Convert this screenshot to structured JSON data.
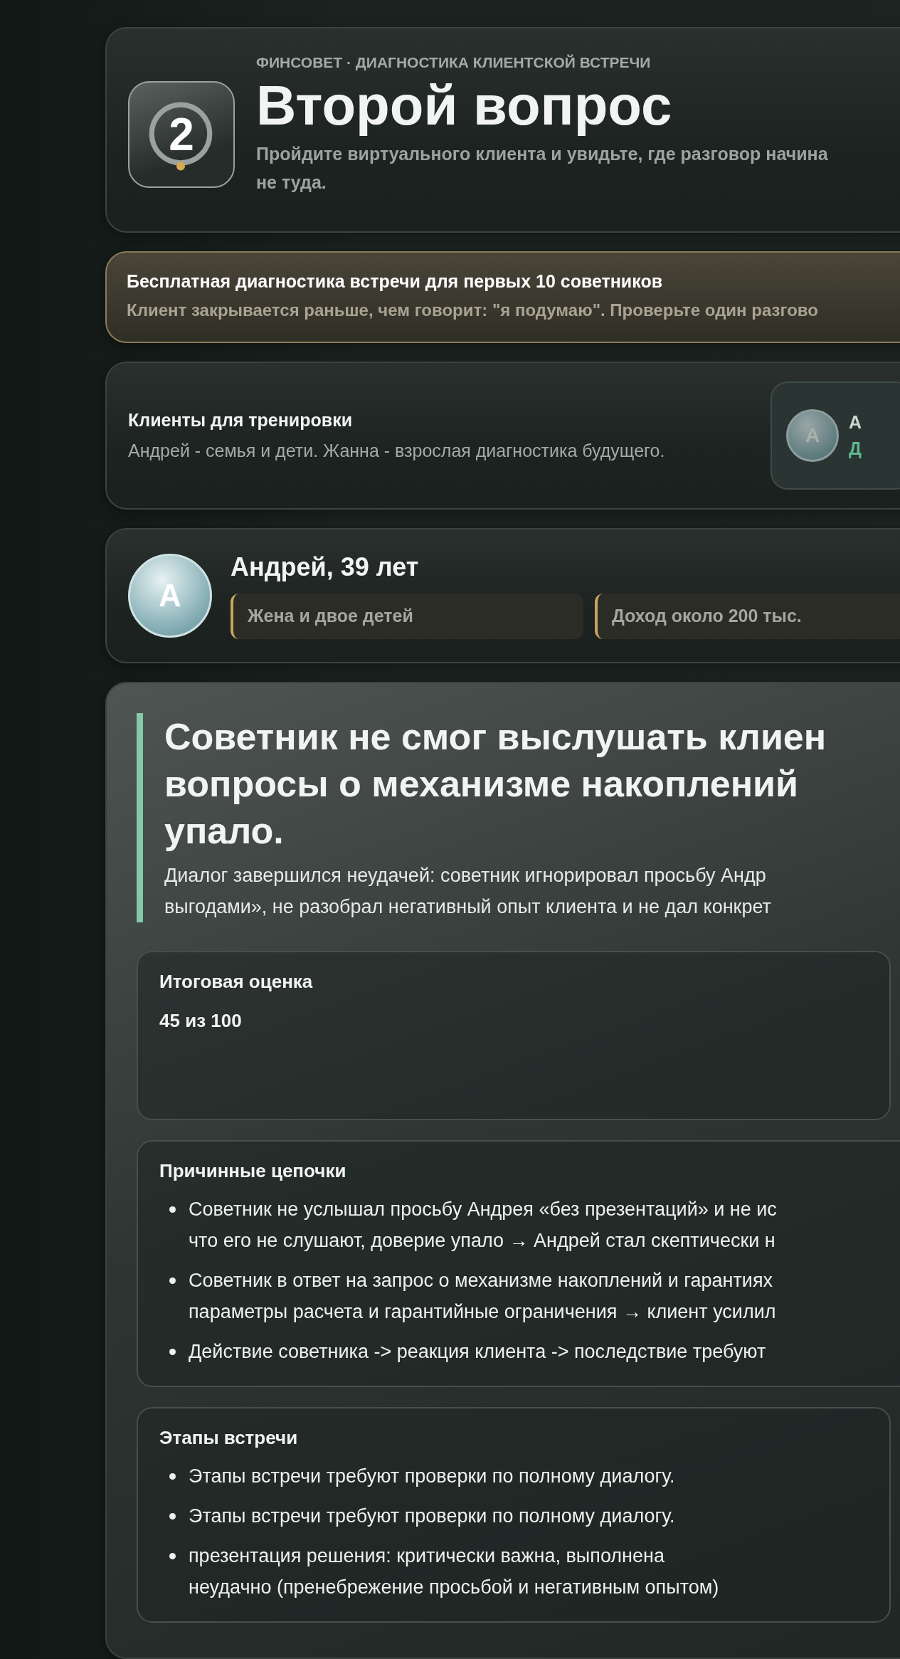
{
  "header": {
    "eyebrow": "ФИНСОВЕТ · ДИАГНОСТИКА КЛИЕНТСКОЙ ВСТРЕЧИ",
    "badge": "2",
    "title": "Второй вопрос",
    "subtitle": "Пройдите виртуального клиента и увидьте, где разговор начина\nне туда."
  },
  "promo": {
    "title": "Бесплатная диагностика встречи для первых 10 советников",
    "text": "Клиент закрывается раньше, чем говорит: \"я подумаю\". Проверьте один разгово"
  },
  "clients": {
    "title": "Клиенты для тренировки",
    "text": "Андрей - семья и дети. Жанна - взрослая диагностика будущего.",
    "chip": {
      "avatar": "А",
      "name": "А",
      "note": "Д"
    }
  },
  "profile": {
    "avatar": "А",
    "name": "Андрей, 39 лет",
    "tags": [
      "Жена и двое детей",
      "Доход около 200 тыс."
    ]
  },
  "result": {
    "headline": "Советник не смог выслушать клиен\nвопросы о механизме накоплений\nупало.",
    "summary": "Диалог завершился неудачей: советник игнорировал просьбу Андр\nвыгодами», не разобрал негативный опыт клиента и не дал конкрет",
    "sections": [
      {
        "kind": "score",
        "title": "Итоговая оценка",
        "value": "45 из 100"
      },
      {
        "kind": "list",
        "title": "Причинные цепочки",
        "items": [
          "Советник не услышал просьбу Андрея «без презентаций» и не ис\nчто его не слушают, доверие упало → Андрей стал скептически н",
          "Советник в ответ на запрос о механизме накоплений и гарантиях\nпараметры расчета и гарантийные ограничения → клиент усилил",
          "Действие советника -> реакция клиента -> последствие требуют"
        ]
      },
      {
        "kind": "list",
        "title": "Этапы встречи",
        "items": [
          "Этапы встречи требуют проверки по полному диалогу.",
          "Этапы встречи требуют проверки по полному диалогу.",
          "презентация решения: критически важна, выполнена\nнеудачно (пренебрежение просьбой и негативным опытом)"
        ]
      }
    ]
  }
}
